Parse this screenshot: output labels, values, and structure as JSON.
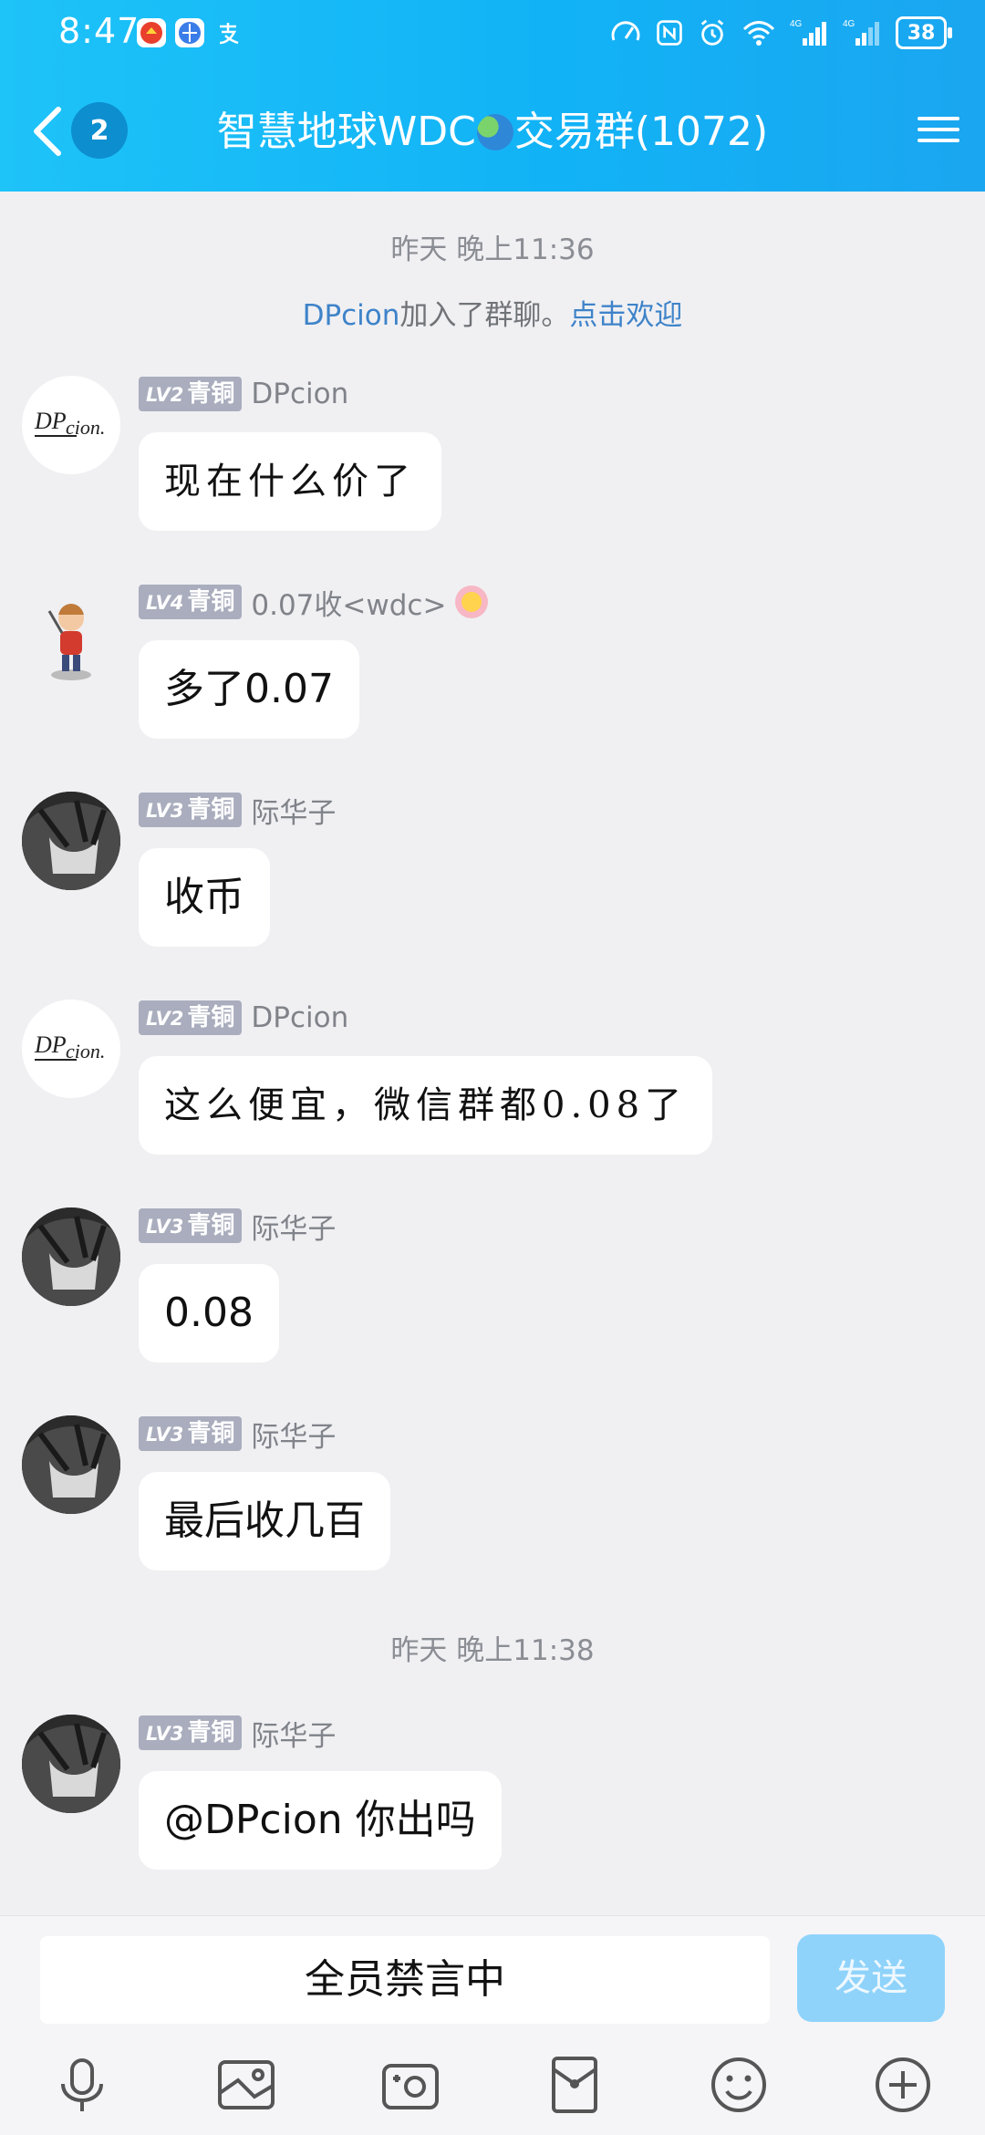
{
  "status_bar": {
    "time": "8:47",
    "battery": "38",
    "signal_labels": [
      "4G",
      "4G"
    ]
  },
  "header": {
    "back_badge": "2",
    "title_left": "智慧地球WDC",
    "title_right": "交易群(1072)"
  },
  "timestamps": [
    "昨天 晚上11:36",
    "昨天 晚上11:38"
  ],
  "system_notice": {
    "name": "DPcion",
    "text": "加入了群聊。",
    "action": "点击欢迎"
  },
  "messages": [
    {
      "level": "LV2",
      "rank": "青铜",
      "nickname": "DPcion",
      "text": "现在什么价了",
      "avatar": "dpcion-logo"
    },
    {
      "level": "LV4",
      "rank": "青铜",
      "nickname": "0.07收<wdc>",
      "text": "多了0.07",
      "avatar": "kid-character"
    },
    {
      "level": "LV3",
      "rank": "青铜",
      "nickname": "际华子",
      "text": "收币",
      "avatar": "dark-anime"
    },
    {
      "level": "LV2",
      "rank": "青铜",
      "nickname": "DPcion",
      "text": "这么便宜，微信群都0.08了",
      "avatar": "dpcion-logo"
    },
    {
      "level": "LV3",
      "rank": "青铜",
      "nickname": "际华子",
      "text": "0.08",
      "avatar": "dark-anime"
    },
    {
      "level": "LV3",
      "rank": "青铜",
      "nickname": "际华子",
      "text": "最后收几百",
      "avatar": "dark-anime"
    },
    {
      "level": "LV3",
      "rank": "青铜",
      "nickname": "际华子",
      "text": "@DPcion 你出吗",
      "avatar": "dark-anime"
    }
  ],
  "input_bar": {
    "placeholder": "全员禁言中",
    "send_label": "发送"
  },
  "toolbar_icons": [
    "microphone-icon",
    "image-icon",
    "camera-icon",
    "red-packet-icon",
    "emoji-icon",
    "plus-icon"
  ],
  "colors": {
    "header_start": "#1ec3f8",
    "header_end": "#1aa6f0",
    "background": "#f0f0f3",
    "link": "#3e83c9",
    "send_disabled": "#8fd3fb",
    "level_badge": "#a9adbd"
  }
}
